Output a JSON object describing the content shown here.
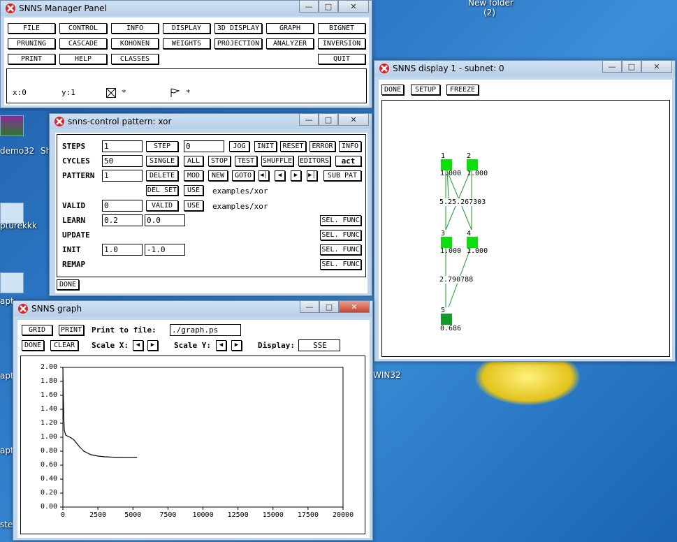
{
  "desktop": {
    "new_folder_label": "New folder",
    "new_folder_count": "(2)",
    "icon_labels": [
      "demo32",
      "Sh",
      "pturekkk",
      "apt",
      "apt",
      "apt",
      "apt",
      "step",
      "WIN32"
    ]
  },
  "manager": {
    "title": "SNNS Manager Panel",
    "buttons": [
      "FILE",
      "CONTROL",
      "INFO",
      "DISPLAY",
      "3D DISPLAY",
      "GRAPH",
      "BIGNET",
      "PRUNING",
      "CASCADE",
      "KOHONEN",
      "WEIGHTS",
      "PROJECTION",
      "ANALYZER",
      "INVERSION",
      "PRINT",
      "HELP",
      "CLASSES",
      "QUIT"
    ],
    "x_label": "x:0",
    "y_label": "y:1",
    "star1": "*",
    "star2": "*"
  },
  "control": {
    "title": "snns-control    pattern: xor",
    "rows": {
      "steps": "STEPS",
      "cycles": "CYCLES",
      "pattern": "PATTERN",
      "valid": "VALID",
      "learn": "LEARN",
      "update": "UPDATE",
      "init": "INIT",
      "remap": "REMAP"
    },
    "steps_value": "1",
    "step_button": "STEP",
    "step_count": "0",
    "jog": "JOG",
    "init_btn": "INIT",
    "reset": "RESET",
    "error": "ERROR",
    "info": "INFO",
    "cycles_value": "50",
    "single": "SINGLE",
    "all": "ALL",
    "stop": "STOP",
    "test": "TEST",
    "shuffle": "SHUFFLE",
    "editors": "EDITORS",
    "act": "act",
    "pattern_value": "1",
    "delete": "DELETE",
    "mod": "MOD",
    "new": "NEW",
    "goto": "GOTO",
    "sub_pat": "SUB PAT",
    "del_set": "DEL SET",
    "use1": "USE",
    "pattern_file": "examples/xor",
    "valid_value": "0",
    "valid_btn": "VALID",
    "use2": "USE",
    "valid_file": "examples/xor",
    "learn_p1": "0.2",
    "learn_p2": "0.0",
    "init_p1": "1.0",
    "init_p2": "-1.0",
    "sel_func": "SEL. FUNC",
    "done": "DONE"
  },
  "display": {
    "title": "SNNS display 1 - subnet: 0",
    "done": "DONE",
    "setup": "SETUP",
    "freeze": "FREEZE",
    "nodes": [
      {
        "id": "1",
        "act": "1.000"
      },
      {
        "id": "2",
        "act": "1.000"
      },
      {
        "id": "3",
        "act": "1.000"
      },
      {
        "id": "4",
        "act": "1.000"
      },
      {
        "id": "5",
        "act": "0.686"
      }
    ],
    "weights_top": "5.25.267303",
    "weights_mid": "2.790788"
  },
  "graph": {
    "title": "SNNS graph",
    "grid": "GRID",
    "print": "PRINT",
    "print_to_file": "Print to file:",
    "file": "./graph.ps",
    "done": "DONE",
    "clear": "CLEAR",
    "scale_x": "Scale X:",
    "scale_y": "Scale Y:",
    "display": "Display:",
    "display_value": "SSE"
  },
  "chart_data": {
    "type": "line",
    "title": "",
    "xlabel": "",
    "ylabel": "",
    "xlim": [
      0,
      20000
    ],
    "ylim": [
      0,
      2.0
    ],
    "x_ticks": [
      "0",
      "2500",
      "5000",
      "7500",
      "10000",
      "12500",
      "15000",
      "17500",
      "20000"
    ],
    "y_ticks": [
      "0.00",
      "0.20",
      "0.40",
      "0.60",
      "0.80",
      "1.00",
      "1.20",
      "1.40",
      "1.60",
      "1.80",
      "2.00"
    ],
    "series": [
      {
        "x": [
          0,
          30,
          60,
          100,
          200,
          300,
          400,
          500,
          600,
          800,
          1000,
          1200,
          1500,
          1800,
          2000,
          2500,
          3000,
          4000,
          5000,
          5300
        ],
        "y": [
          2.0,
          1.6,
          1.3,
          1.1,
          1.03,
          1.02,
          1.01,
          1.0,
          0.99,
          0.96,
          0.91,
          0.86,
          0.8,
          0.77,
          0.75,
          0.73,
          0.72,
          0.71,
          0.71,
          0.71
        ]
      }
    ]
  }
}
